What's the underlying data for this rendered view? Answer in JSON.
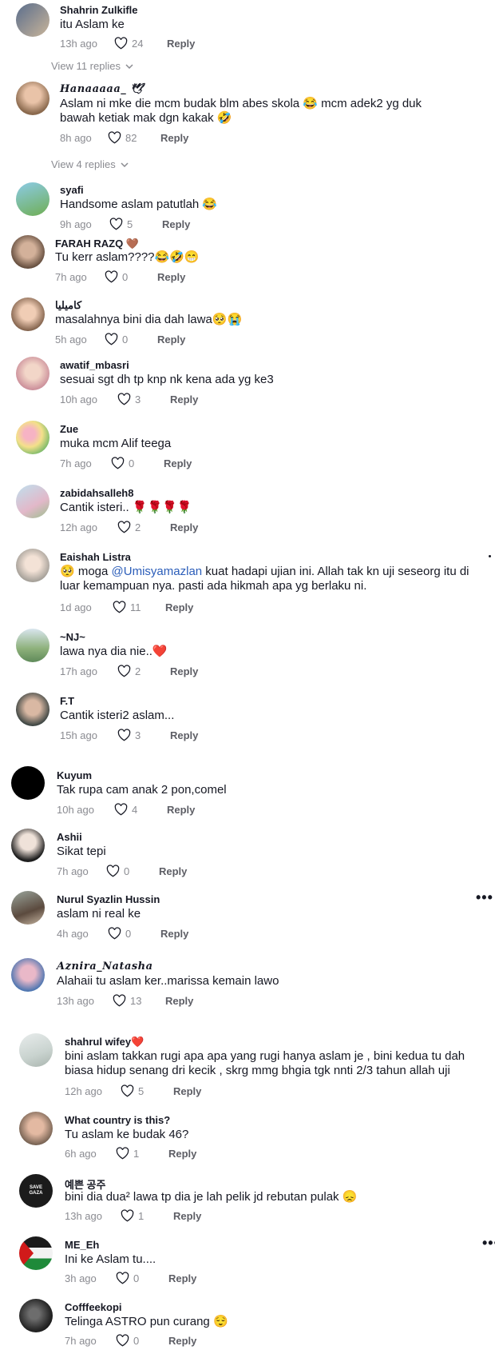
{
  "view_replies": [
    "View 11 replies",
    "View 4 replies"
  ],
  "comments": [
    {
      "name": "Shahrin Zulkifle",
      "text": "itu Aslam ke",
      "time": "13h ago",
      "likes": "24",
      "reply": "Reply"
    },
    {
      "name": "Hanaaaaa_ 🕊",
      "text": "Aslam ni mke die mcm budak blm abes skola 😂 mcm adek2 yg duk bawah ketiak mak dgn kakak 🤣",
      "time": "8h ago",
      "likes": "82",
      "reply": "Reply"
    },
    {
      "name": "syafi",
      "text": "Handsome aslam patutlah 😂",
      "time": "9h ago",
      "likes": "5",
      "reply": "Reply"
    },
    {
      "name": "FARAH RAZQ 🤎",
      "text": "Tu kerr aslam????😂🤣😁",
      "time": "7h ago",
      "likes": "0",
      "reply": "Reply"
    },
    {
      "name": "كاميليا",
      "text": "masalahnya bini dia dah lawa🥺😭",
      "time": "5h ago",
      "likes": "0",
      "reply": "Reply"
    },
    {
      "name": "awatif_mbasri",
      "text": "sesuai sgt dh tp knp nk kena ada yg ke3",
      "time": "10h ago",
      "likes": "3",
      "reply": "Reply"
    },
    {
      "name": "Zue",
      "text": "muka mcm Alif teega",
      "time": "7h ago",
      "likes": "0",
      "reply": "Reply"
    },
    {
      "name": "zabidahsalleh8",
      "text": "Cantik isteri.. 🌹🌹🌹🌹",
      "time": "12h ago",
      "likes": "2",
      "reply": "Reply"
    },
    {
      "name": "Eaishah Listra",
      "text_pre": "🥺 moga ",
      "mention": "@Umisyamazlan",
      "text_post": " kuat hadapi ujian ini. Allah tak kn uji seseorg itu di luar kemampuan nya. pasti ada hikmah apa yg berlaku ni.",
      "time": "1d ago",
      "likes": "11",
      "reply": "Reply"
    },
    {
      "name": "~NJ~",
      "text": "lawa nya dia nie..❤️",
      "time": "17h ago",
      "likes": "2",
      "reply": "Reply"
    },
    {
      "name": "F.T",
      "text": "Cantik isteri2 aslam...",
      "time": "15h ago",
      "likes": "3",
      "reply": "Reply"
    },
    {
      "name": "Kuyum",
      "text": "Tak rupa cam anak 2 pon,comel",
      "time": "10h ago",
      "likes": "4",
      "reply": "Reply"
    },
    {
      "name": "Ashii",
      "text": "Sikat tepi",
      "time": "7h ago",
      "likes": "0",
      "reply": "Reply"
    },
    {
      "name": "Nurul Syazlin Hussin",
      "text": "aslam ni real ke",
      "time": "4h ago",
      "likes": "0",
      "reply": "Reply"
    },
    {
      "name": "Aznira_Natasha",
      "text": "Alahaii tu aslam ker..marissa kemain lawo",
      "time": "13h ago",
      "likes": "13",
      "reply": "Reply"
    },
    {
      "name": "shahrul wifey❤️",
      "text": "bini aslam takkan rugi apa apa yang rugi hanya aslam je , bini kedua tu dah biasa hidup senang dri kecik , skrg mmg bhgia tgk nnti 2/3 tahun allah uji",
      "time": "12h ago",
      "likes": "5",
      "reply": "Reply"
    },
    {
      "name": "What country is this?",
      "text": "Tu aslam ke budak 46?",
      "time": "6h ago",
      "likes": "1",
      "reply": "Reply"
    },
    {
      "name": "예쁜 공주",
      "text": "bini dia dua² lawa tp dia je lah pelik jd rebutan pulak 😞",
      "time": "13h ago",
      "likes": "1",
      "reply": "Reply"
    },
    {
      "name": "ME_Eh",
      "text": "Ini ke Aslam tu....",
      "time": "3h ago",
      "likes": "0",
      "reply": "Reply"
    },
    {
      "name": "Cofffeekopi",
      "text": "Telinga ASTRO pun curang 😌",
      "time": "7h ago",
      "likes": "0",
      "reply": "Reply"
    }
  ],
  "avatar_badge": "SAVE GAZA",
  "colors": {
    "text": "#161823",
    "muted": "#8a8b91",
    "mention": "#2b5db9"
  }
}
